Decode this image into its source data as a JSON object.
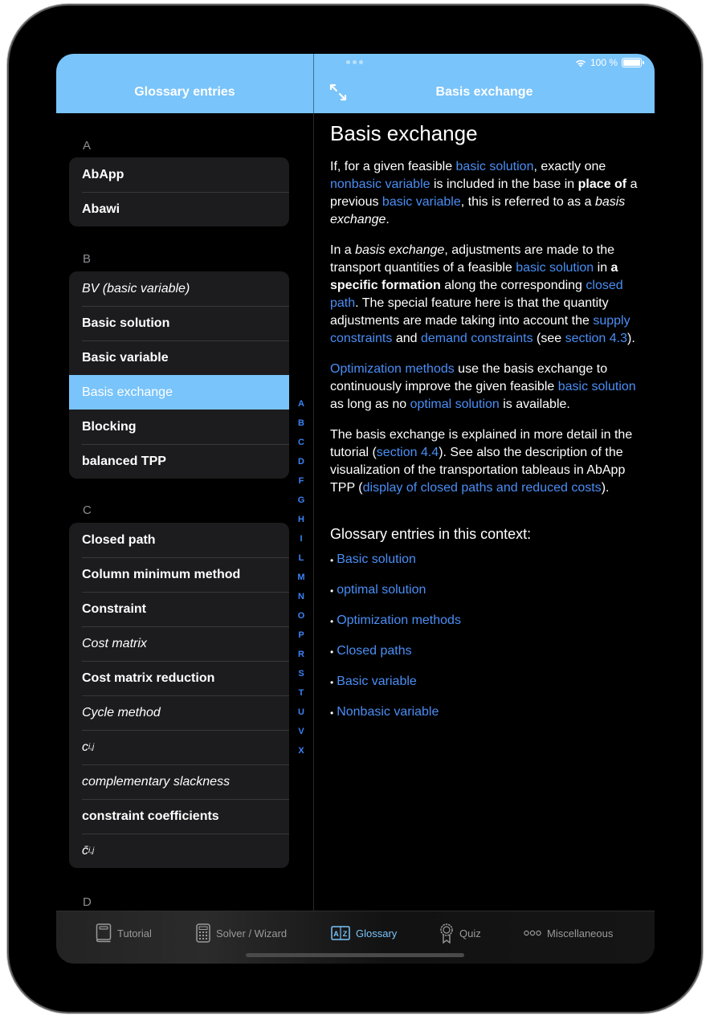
{
  "status_bar": {
    "battery_text": "100 %",
    "wifi_icon": "wifi-icon",
    "battery_level": 1.0
  },
  "header": {
    "left_title": "Glossary entries",
    "right_title": "Basis exchange",
    "expand_icon": "arrows-expand-icon"
  },
  "sidebar": {
    "sections": [
      {
        "letter": "A",
        "items": [
          {
            "label": "AbApp",
            "style": "bold"
          },
          {
            "label": "Abawi",
            "style": "bold"
          }
        ]
      },
      {
        "letter": "B",
        "items": [
          {
            "label": "BV (basic variable)",
            "style": "italic"
          },
          {
            "label": "Basic solution",
            "style": "bold"
          },
          {
            "label": "Basic variable",
            "style": "bold"
          },
          {
            "label": "Basis exchange",
            "style": "selected"
          },
          {
            "label": "Blocking",
            "style": "bold"
          },
          {
            "label": "balanced TPP",
            "style": "bold"
          }
        ]
      },
      {
        "letter": "C",
        "items": [
          {
            "label": "Closed path",
            "style": "bold"
          },
          {
            "label": "Column minimum method",
            "style": "bold"
          },
          {
            "label": "Constraint",
            "style": "bold"
          },
          {
            "label": "Cost matrix",
            "style": "italic"
          },
          {
            "label": "Cost matrix reduction",
            "style": "bold"
          },
          {
            "label": "Cycle method",
            "style": "italic"
          },
          {
            "label": "c",
            "sub": "i,j",
            "style": "italic"
          },
          {
            "label": "complementary slackness",
            "style": "italic"
          },
          {
            "label": "constraint coefficients",
            "style": "bold"
          },
          {
            "label": "c̄",
            "sub": "i,j",
            "style": "italic"
          }
        ]
      },
      {
        "letter": "D",
        "items": []
      }
    ],
    "index_letters": [
      "A",
      "B",
      "C",
      "D",
      "F",
      "G",
      "H",
      "I",
      "L",
      "M",
      "N",
      "O",
      "P",
      "R",
      "S",
      "T",
      "U",
      "V",
      "X"
    ]
  },
  "detail": {
    "title": "Basis exchange",
    "p1": {
      "t1": "If, for a given feasible ",
      "l1": "basic solution",
      "t2": ", exactly one ",
      "l2": "nonbasic variable",
      "t3": " is included in the base in ",
      "b1": "place of",
      "t4": " a previous ",
      "l3": "basic variable",
      "t5": ", this is referred to as a ",
      "i1": "basis exchange",
      "t6": "."
    },
    "p2": {
      "t1": "In a ",
      "i1": "basis exchange",
      "t2": ", adjustments are made to the transport quantities of a feasible ",
      "l1": "basic solution",
      "t3": " in ",
      "b1": "a specific formation",
      "t4": " along the corresponding ",
      "l2": "closed path",
      "t5": ". The special feature here is that the quantity adjustments are made taking into account the ",
      "l3": "supply constraints",
      "t6": " and ",
      "l4": "demand constraints",
      "t7": " (see ",
      "l5": "section 4.3",
      "t8": ")."
    },
    "p3": {
      "l1": "Optimization methods",
      "t1": " use the basis exchange to continuously improve the given feasible ",
      "l2": "basic solution",
      "t2": " as long as no ",
      "l3": "optimal solution",
      "t3": " is available."
    },
    "p4": {
      "t1": "The basis exchange is explained in more detail in the tutorial (",
      "l1": "section 4.4",
      "t2": "). See also the description of the visualization of the transportation tableaus in AbApp TPP (",
      "l2": "display of closed paths and reduced costs",
      "t3": ")."
    },
    "context_heading": "Glossary entries in this context:",
    "bullet": "•",
    "context_links": [
      "Basic solution",
      "optimal solution",
      "Optimization methods",
      "Closed paths",
      "Basic variable",
      "Nonbasic variable"
    ]
  },
  "tabbar": {
    "tabs": [
      {
        "label": "Tutorial",
        "icon": "book-icon",
        "active": false
      },
      {
        "label": "Solver / Wizard",
        "icon": "calculator-icon",
        "active": false
      },
      {
        "label": "Glossary",
        "icon": "az-glossary-icon",
        "active": true
      },
      {
        "label": "Quiz",
        "icon": "award-ribbon-icon",
        "active": false
      },
      {
        "label": "Miscellaneous",
        "icon": "ellipsis-circles-icon",
        "active": false
      }
    ]
  },
  "colors": {
    "accent": "#79c4fa",
    "link": "#4a8ef5",
    "index": "#3b82f6",
    "background": "#000000",
    "row_bg": "#1c1c1e"
  }
}
